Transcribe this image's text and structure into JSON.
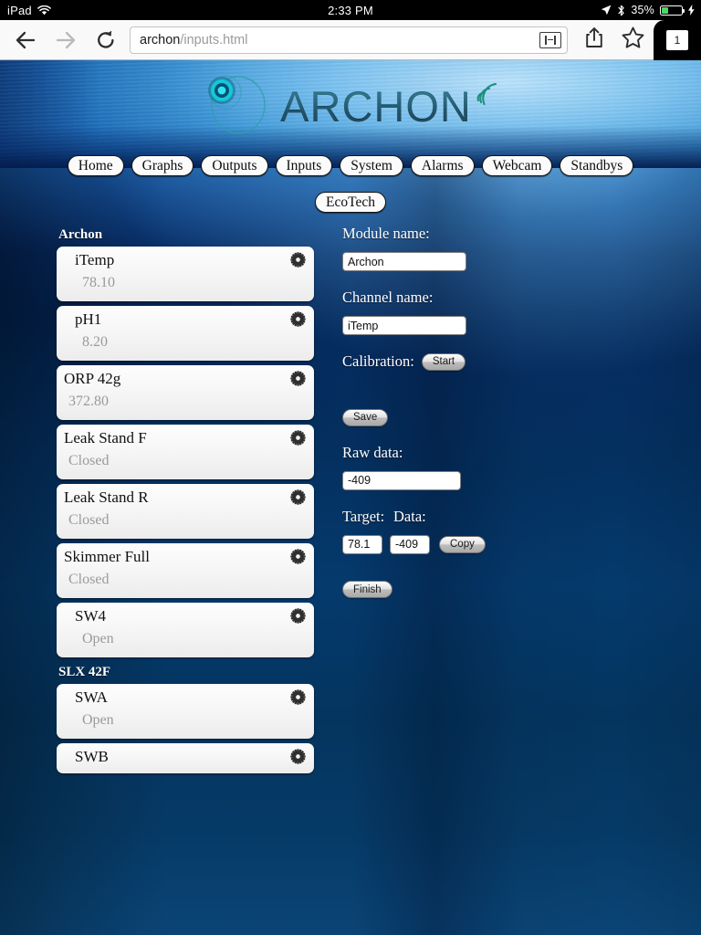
{
  "status_bar": {
    "device": "iPad",
    "wifi_icon": "wifi-icon",
    "time": "2:33 PM",
    "location_icon": "location-arrow-icon",
    "bluetooth_icon": "bluetooth-icon",
    "battery_percent": "35%",
    "battery_level": 35,
    "battery_charging": true
  },
  "browser": {
    "back_icon": "back-arrow-icon",
    "forward_icon": "forward-arrow-icon",
    "reload_icon": "reload-icon",
    "url_host": "archon",
    "url_path": "/inputs.html",
    "reader_icon": "reader-view-icon",
    "share_icon": "share-icon",
    "bookmark_icon": "bookmark-star-icon",
    "tab_count": "1"
  },
  "header": {
    "logo_text": "ARCHON",
    "logo_mark_icon": "archon-circle-logo-icon",
    "signal_icon": "wifi-signal-icon"
  },
  "nav": {
    "row1": [
      {
        "label": "Home"
      },
      {
        "label": "Graphs"
      },
      {
        "label": "Outputs"
      },
      {
        "label": "Inputs"
      },
      {
        "label": "System"
      },
      {
        "label": "Alarms"
      },
      {
        "label": "Webcam"
      },
      {
        "label": "Standbys"
      }
    ],
    "row2": [
      {
        "label": "EcoTech"
      }
    ]
  },
  "channel_list": {
    "groups": [
      {
        "name": "Archon",
        "items": [
          {
            "name": "iTemp",
            "value": "78.10",
            "indent": 1,
            "gear_icon": "gear-icon"
          },
          {
            "name": "pH1",
            "value": "8.20",
            "indent": 1,
            "gear_icon": "gear-icon"
          },
          {
            "name": "ORP 42g",
            "value": "372.80",
            "indent": 0,
            "gear_icon": "gear-icon"
          },
          {
            "name": "Leak Stand F",
            "value": "Closed",
            "indent": 0,
            "gear_icon": "gear-icon"
          },
          {
            "name": "Leak Stand R",
            "value": "Closed",
            "indent": 0,
            "gear_icon": "gear-icon"
          },
          {
            "name": "Skimmer Full",
            "value": "Closed",
            "indent": 0,
            "gear_icon": "gear-icon"
          },
          {
            "name": "SW4",
            "value": "Open",
            "indent": 1,
            "gear_icon": "gear-icon"
          }
        ]
      },
      {
        "name": "SLX 42F",
        "items": [
          {
            "name": "SWA",
            "value": "Open",
            "indent": 1,
            "gear_icon": "gear-icon"
          },
          {
            "name": "SWB",
            "value": "",
            "indent": 1,
            "gear_icon": "gear-icon",
            "clipped": true
          }
        ]
      }
    ]
  },
  "form": {
    "module_name_label": "Module name:",
    "module_name_value": "Archon",
    "channel_name_label": "Channel name:",
    "channel_name_value": "iTemp",
    "calibration_label": "Calibration:",
    "start_button": "Start",
    "save_button": "Save",
    "raw_data_label": "Raw data:",
    "raw_data_value": "-409",
    "target_label": "Target:",
    "data_label": "Data:",
    "target_value": "78.1",
    "data_value": "-409",
    "copy_button": "Copy",
    "finish_button": "Finish"
  },
  "colors": {
    "page_deep_blue": "#03204f",
    "header_light_blue": "#7cc4f2",
    "logo_teal": "#14576f",
    "card_bg": "#f7f7f7",
    "card_value_gray": "#9a9a9a",
    "battery_green": "#4cd964"
  }
}
